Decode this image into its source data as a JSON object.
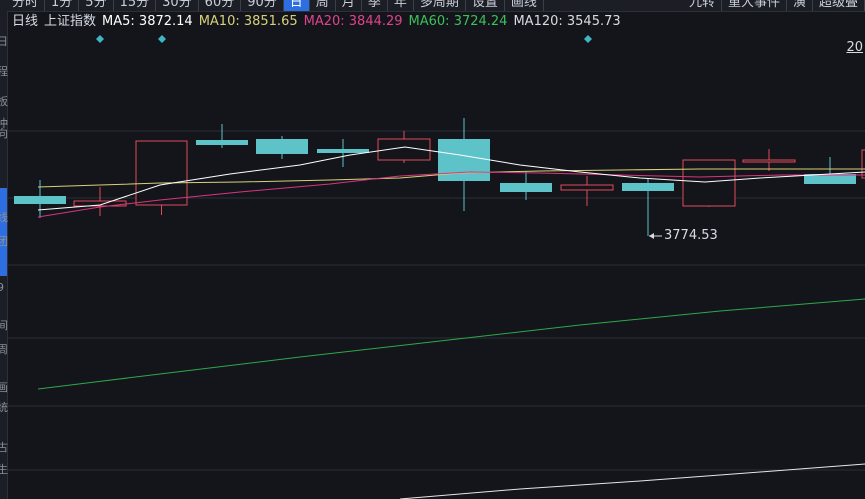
{
  "toolbar": {
    "tabs": [
      "分时",
      "1分",
      "5分",
      "15分",
      "30分",
      "60分",
      "90分",
      "日",
      "周",
      "月",
      "季",
      "年",
      "多周期",
      "设置",
      "画线"
    ],
    "active_tab": "日",
    "right_tabs": [
      "九转",
      "重大事件",
      "演",
      "超级叠"
    ]
  },
  "sidebar": {
    "fragments": [
      "日",
      "程",
      "板",
      "冲",
      "向",
      "线",
      "团",
      "9",
      "间",
      "周",
      "画",
      "统",
      "古",
      "生"
    ]
  },
  "legend": {
    "period": "日线",
    "index_name": "上证指数",
    "ma5": "MA5: 3872.14",
    "ma10": "MA10: 3851.65",
    "ma20": "MA20: 3844.29",
    "ma60": "MA60: 3724.24",
    "ma120": "MA120: 3545.73"
  },
  "colors": {
    "background": "#13151b",
    "up": "#e24b5a",
    "down": "#5ec2c9",
    "ma5": "#ffffff",
    "ma10": "#d8d17a",
    "ma20": "#d8357e",
    "ma60": "#2ea84a",
    "grid": "#2a2e36",
    "active_tab": "#2d6fe0",
    "marker": "#3fb6c2"
  },
  "corner_label": "20",
  "chart_data": {
    "type": "candlestick",
    "y_ref_low": 3774.53,
    "low_label": "3774.53",
    "candles": [
      {
        "dir": "down"
      },
      {
        "dir": "up"
      },
      {
        "dir": "up"
      },
      {
        "dir": "down"
      },
      {
        "dir": "down"
      },
      {
        "dir": "down"
      },
      {
        "dir": "up"
      },
      {
        "dir": "down"
      },
      {
        "dir": "down"
      },
      {
        "dir": "up"
      },
      {
        "dir": "down"
      },
      {
        "dir": "up"
      },
      {
        "dir": "up"
      },
      {
        "dir": "down"
      },
      {
        "dir": "up"
      }
    ],
    "markers": 3
  }
}
